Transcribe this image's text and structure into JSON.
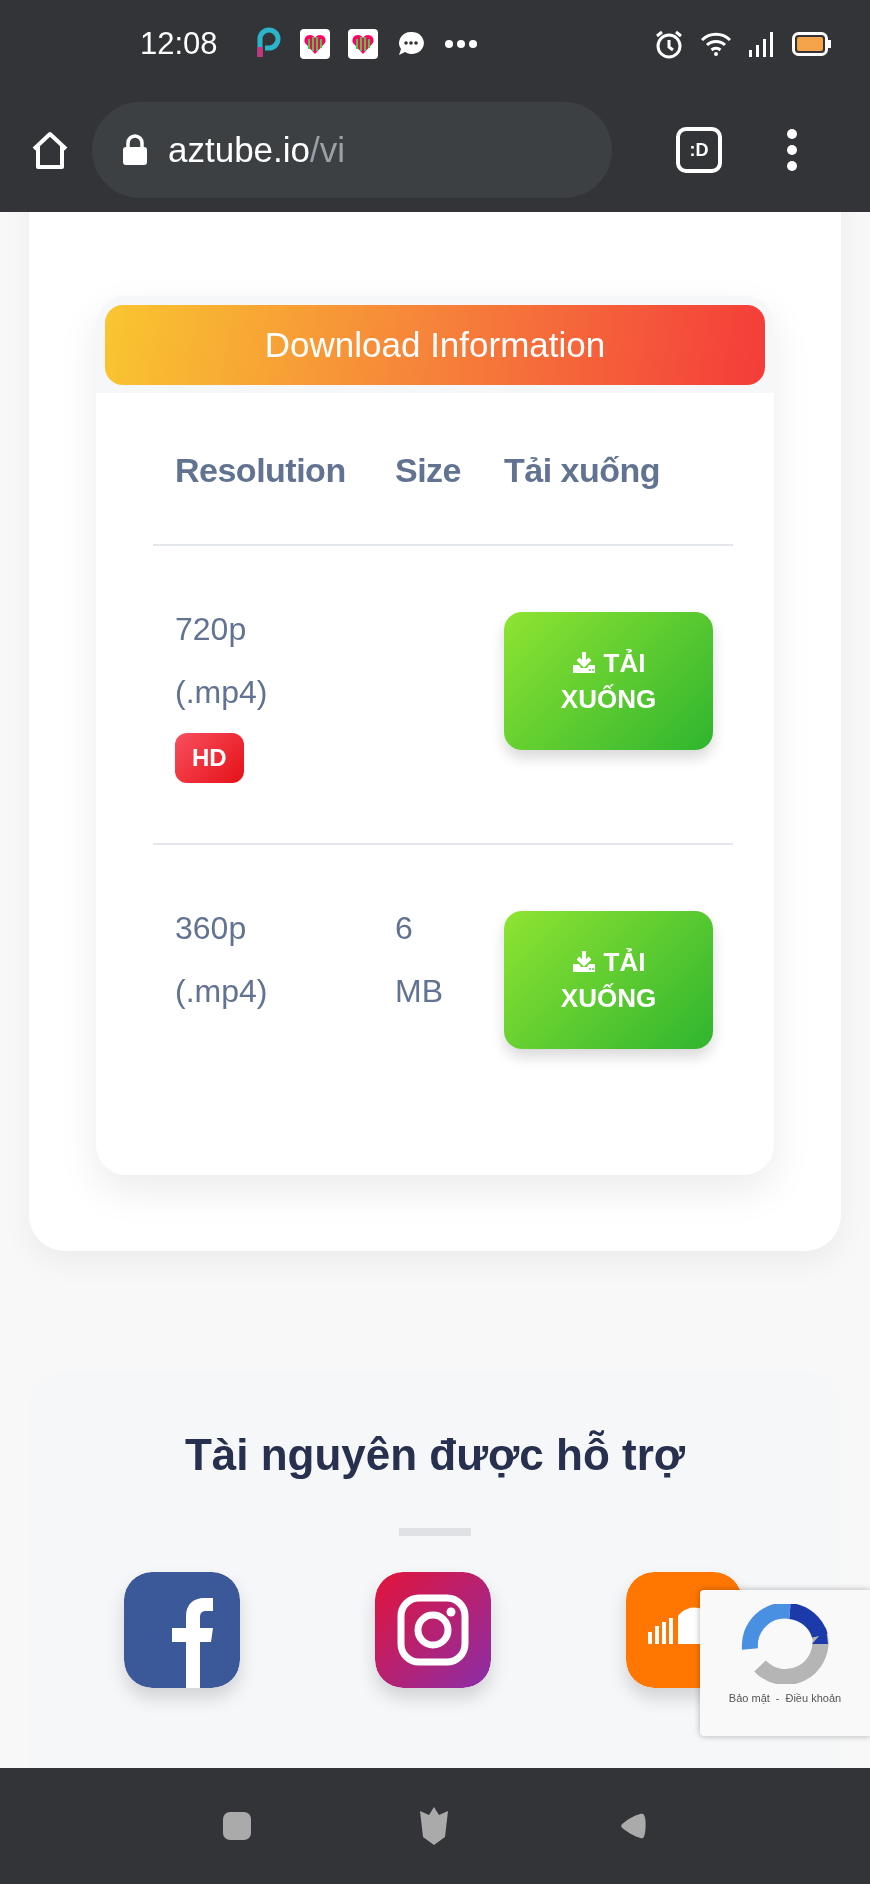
{
  "status_bar": {
    "time": "12:08"
  },
  "browser": {
    "url_host": "aztube.io",
    "url_path": "/vi",
    "tab_button": ":D"
  },
  "download_card": {
    "title": "Download Information",
    "columns": [
      "Resolution",
      "Size",
      "Tải xuống"
    ],
    "rows": [
      {
        "resolution": "720p (.mp4)",
        "badge": "HD",
        "button": "TẢI XUỐNG"
      },
      {
        "resolution": "360p (.mp4)",
        "size": "6 MB",
        "button": "TẢI XUỐNG"
      }
    ]
  },
  "supported": {
    "title": "Tài nguyên được hỗ trợ",
    "sources": [
      {
        "kind": "facebook"
      },
      {
        "kind": "instagram"
      },
      {
        "kind": "soundcloud"
      }
    ]
  },
  "recaptcha": {
    "privacy": "Bảo mật",
    "separator": "-",
    "terms": "Điều khoản"
  }
}
